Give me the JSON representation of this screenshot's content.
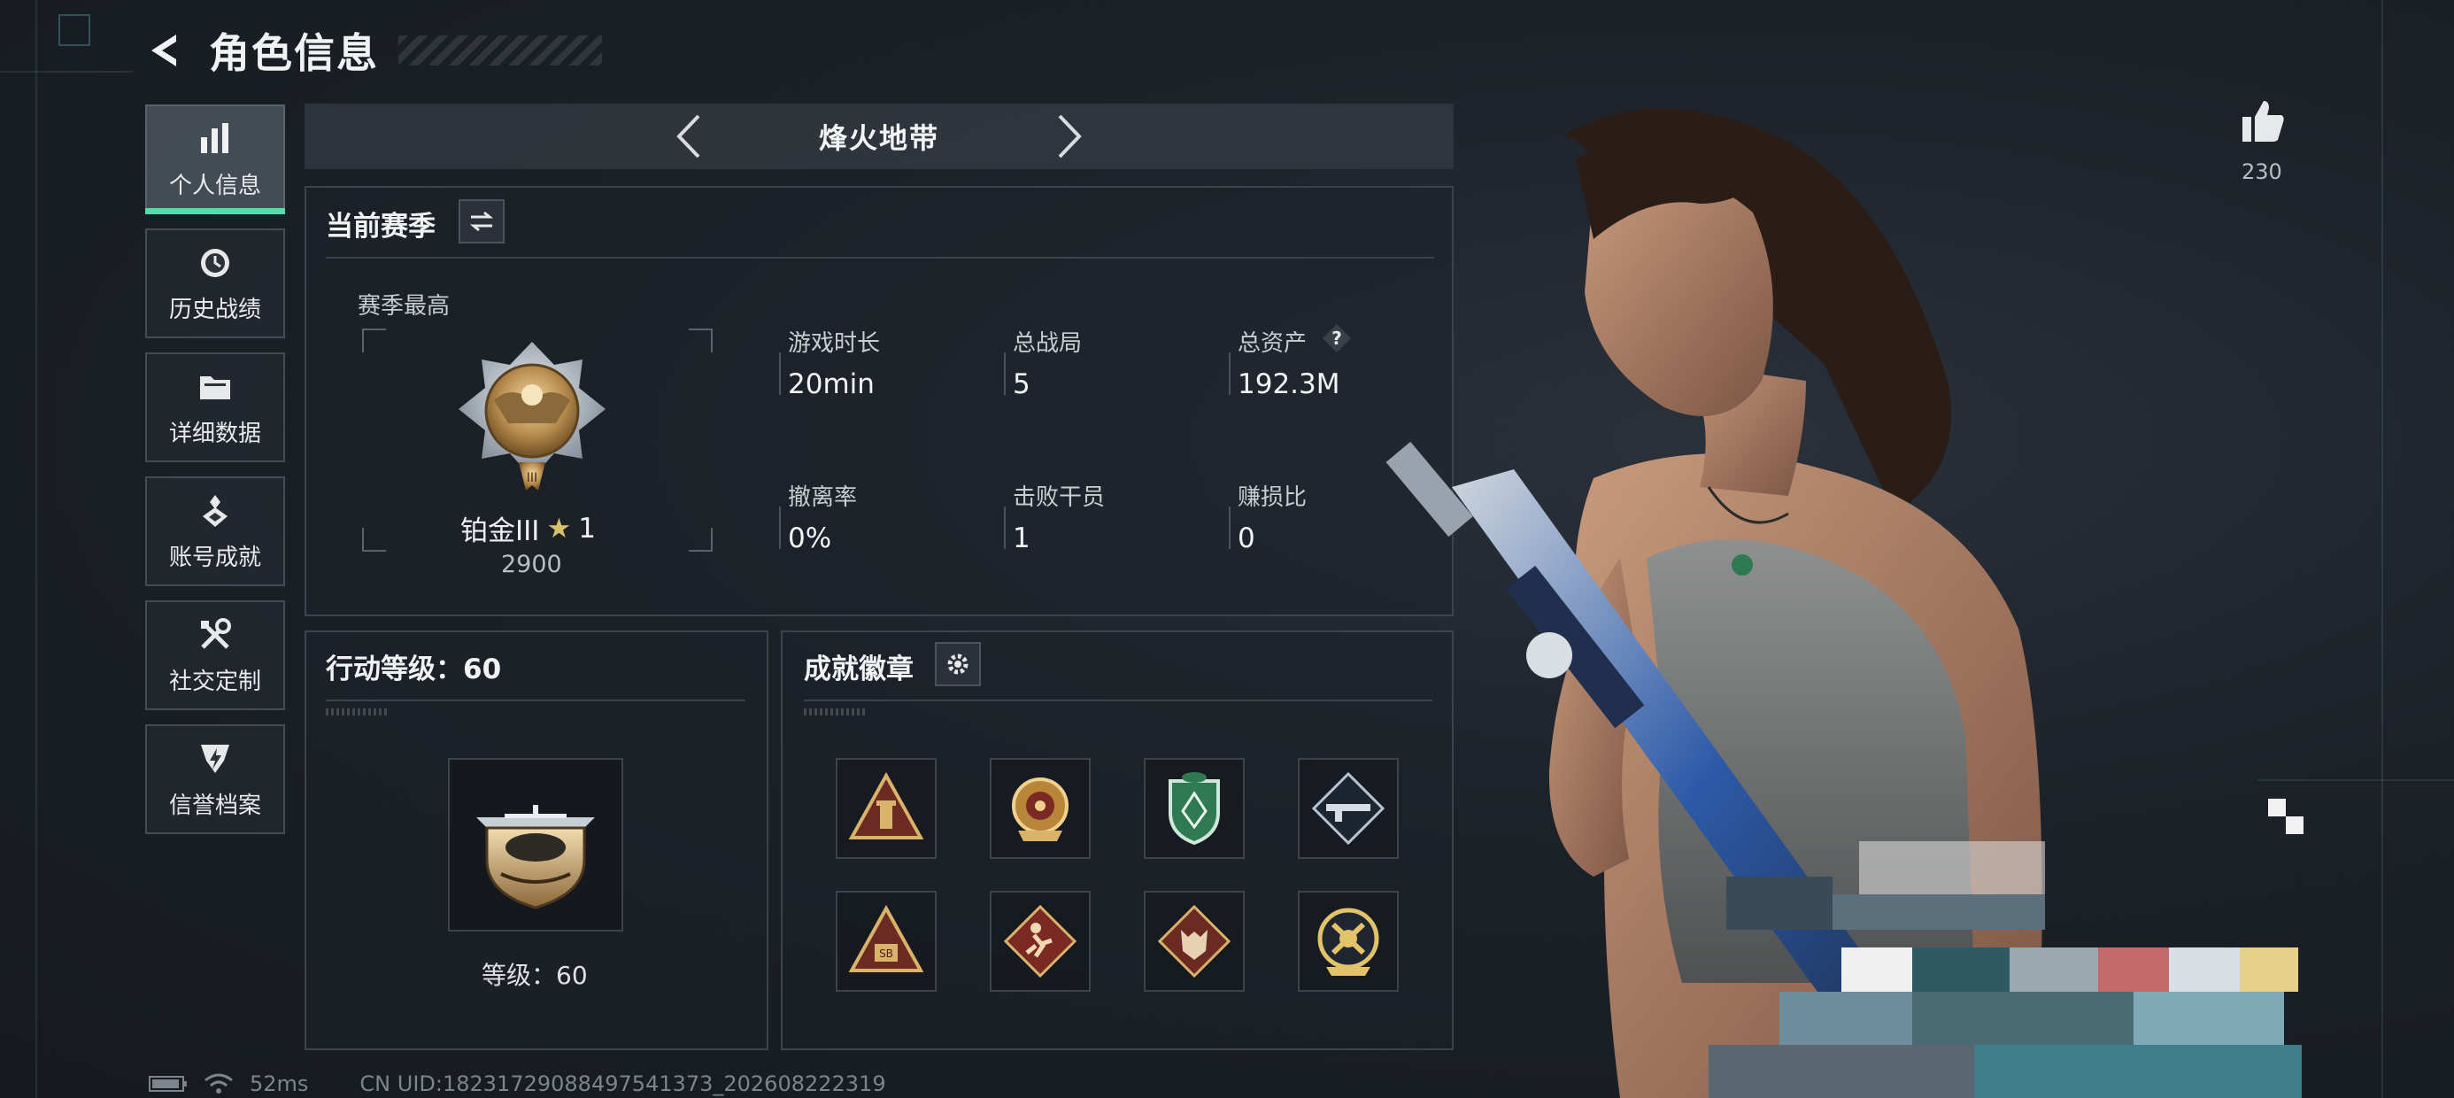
{
  "header": {
    "title": "角色信息"
  },
  "sidebar": {
    "items": [
      {
        "label": "个人信息",
        "icon": "bar-chart-icon",
        "active": true
      },
      {
        "label": "历史战绩",
        "icon": "history-clock-icon",
        "active": false
      },
      {
        "label": "详细数据",
        "icon": "folder-icon",
        "active": false
      },
      {
        "label": "账号成就",
        "icon": "achievement-medal-icon",
        "active": false
      },
      {
        "label": "社交定制",
        "icon": "tools-icon",
        "active": false
      },
      {
        "label": "信誉档案",
        "icon": "reputation-shield-icon",
        "active": false
      }
    ]
  },
  "mode": {
    "title": "烽火地带"
  },
  "season": {
    "title": "当前赛季",
    "best_label": "赛季最高",
    "rank_name": "铂金III",
    "rank_stars": "1",
    "rank_score": "2900",
    "stats": [
      {
        "label": "游戏时长",
        "value": "20min"
      },
      {
        "label": "总战局",
        "value": "5"
      },
      {
        "label": "总资产",
        "value": "192.3M",
        "help": "?"
      },
      {
        "label": "撤离率",
        "value": "0%"
      },
      {
        "label": "击败干员",
        "value": "1"
      },
      {
        "label": "赚损比",
        "value": "0"
      }
    ]
  },
  "level": {
    "title": "行动等级：60",
    "caption": "等级：60"
  },
  "achievements": {
    "title": "成就徽章",
    "badges": [
      "triangle-tower-badge-icon",
      "golden-wreath-badge-icon",
      "green-shield-badge-icon",
      "rifle-diamond-badge-icon",
      "triangle-sb-badge-icon",
      "runner-diamond-badge-icon",
      "wolf-diamond-badge-icon",
      "gold-emblem-badge-icon"
    ]
  },
  "likes": {
    "count": "230"
  },
  "footer": {
    "ping": "52ms",
    "uid": "CN UID:18231729088497541373_202608222319"
  },
  "colors": {
    "accent_green": "#4fe0a8",
    "panel_border": "#3c434b",
    "background": "#1c2128"
  }
}
